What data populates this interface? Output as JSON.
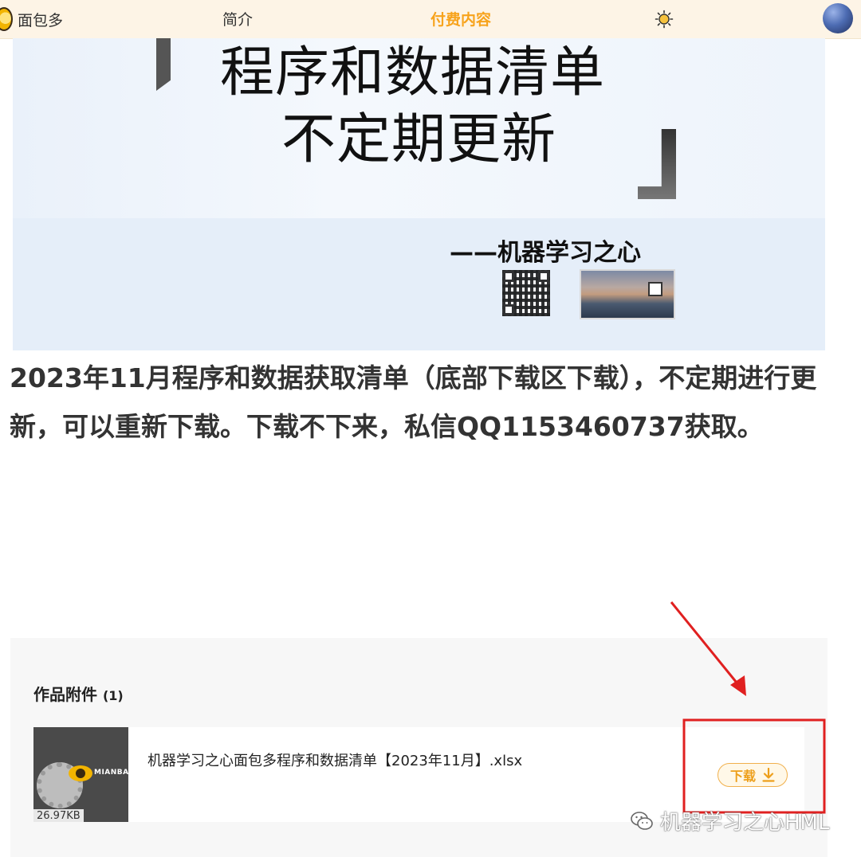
{
  "header": {
    "brand": "面包多",
    "tabs": [
      {
        "label": "简介",
        "active": false
      },
      {
        "label": "付费内容",
        "active": true
      }
    ],
    "theme_icon": "sun-icon",
    "avatar_icon": "planet-avatar"
  },
  "cover": {
    "title_line1": "程序和数据清单",
    "title_line2": "不定期更新",
    "author": "——机器学习之心"
  },
  "article": {
    "text": "2023年11月程序和数据获取清单（底部下载区下载），不定期进行更新，可以重新下载。下载不下来，私信QQ1153460737获取。"
  },
  "attachments": {
    "title": "作品附件",
    "count": "(1)",
    "files": [
      {
        "name": "机器学习之心面包多程序和数据清单【2023年11月】.xlsx",
        "size": "26.97KB",
        "thumb_brand": "MIANBAO",
        "download_label": "下载"
      }
    ]
  },
  "watermark": {
    "text": "机器学习之心HML"
  },
  "colors": {
    "accent": "#f7a31c",
    "topbar_bg": "#fdf4e6",
    "annotation_red": "#e02020"
  }
}
